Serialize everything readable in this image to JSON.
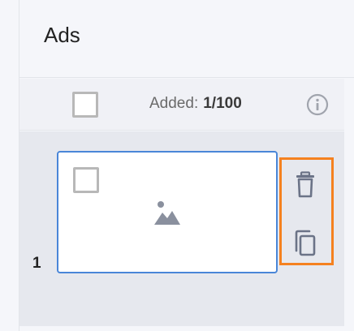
{
  "header": {
    "title": "Ads"
  },
  "toolbar": {
    "added_label": "Added:",
    "added_count": "1/100",
    "info_icon": "info-icon"
  },
  "rows": [
    {
      "number": "1",
      "thumbnail_icon": "image-icon",
      "actions": [
        "trash-icon",
        "copy-icon"
      ]
    }
  ],
  "colors": {
    "card_border": "#4a86d8",
    "highlight_border": "#f5811f",
    "icon": "#6b7387"
  }
}
